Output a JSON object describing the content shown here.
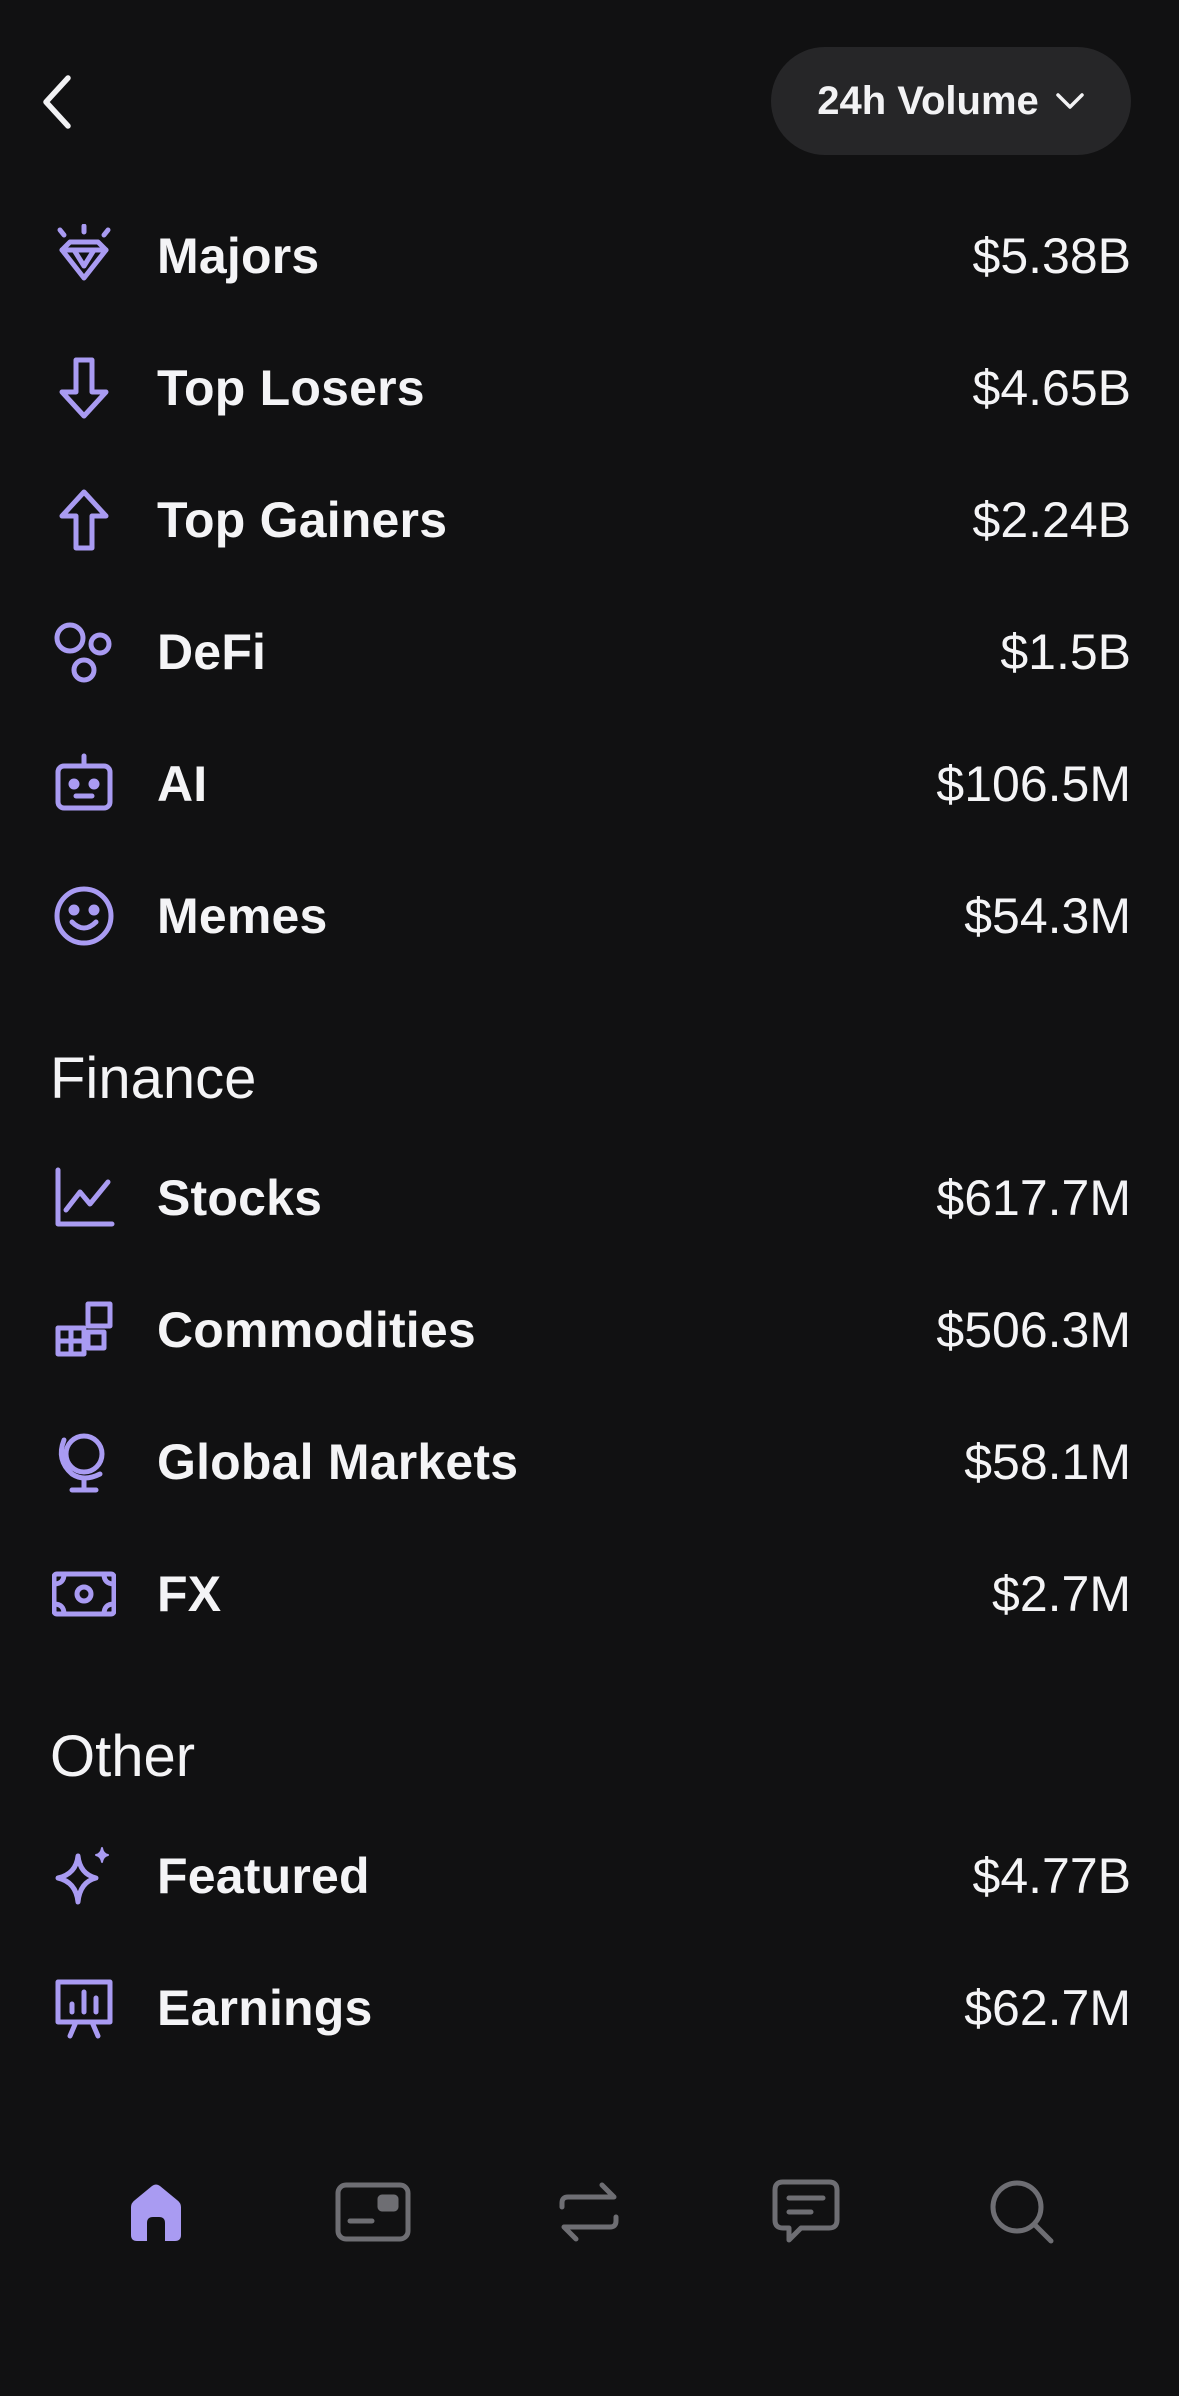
{
  "header": {
    "volume_selector_label": "24h Volume"
  },
  "colors": {
    "accent": "#A99BF2",
    "background": "#111112",
    "pill": "#262628",
    "inactive_icon": "#6E6E73"
  },
  "groups": {
    "top": [
      {
        "label": "Majors",
        "value": "$5.38B",
        "icon": "gem-icon"
      },
      {
        "label": "Top Losers",
        "value": "$4.65B",
        "icon": "arrow-down-icon"
      },
      {
        "label": "Top Gainers",
        "value": "$2.24B",
        "icon": "arrow-up-icon"
      },
      {
        "label": "DeFi",
        "value": "$1.5B",
        "icon": "circles-icon"
      },
      {
        "label": "AI",
        "value": "$106.5M",
        "icon": "robot-icon"
      },
      {
        "label": "Memes",
        "value": "$54.3M",
        "icon": "smiley-icon"
      }
    ],
    "finance": {
      "title": "Finance",
      "items": [
        {
          "label": "Stocks",
          "value": "$617.7M",
          "icon": "line-chart-icon"
        },
        {
          "label": "Commodities",
          "value": "$506.3M",
          "icon": "boxes-icon"
        },
        {
          "label": "Global Markets",
          "value": "$58.1M",
          "icon": "globe-icon"
        },
        {
          "label": "FX",
          "value": "$2.7M",
          "icon": "banknote-icon"
        }
      ]
    },
    "other": {
      "title": "Other",
      "items": [
        {
          "label": "Featured",
          "value": "$4.77B",
          "icon": "sparkle-icon"
        },
        {
          "label": "Earnings",
          "value": "$62.7M",
          "icon": "presentation-chart-icon"
        }
      ]
    }
  },
  "tabbar": {
    "tabs": [
      {
        "name": "home",
        "icon": "home-icon",
        "active": true
      },
      {
        "name": "wallet",
        "icon": "wallet-icon",
        "active": false
      },
      {
        "name": "trade",
        "icon": "swap-icon",
        "active": false
      },
      {
        "name": "chat",
        "icon": "chat-icon",
        "active": false
      },
      {
        "name": "search",
        "icon": "search-icon",
        "active": false
      }
    ]
  }
}
